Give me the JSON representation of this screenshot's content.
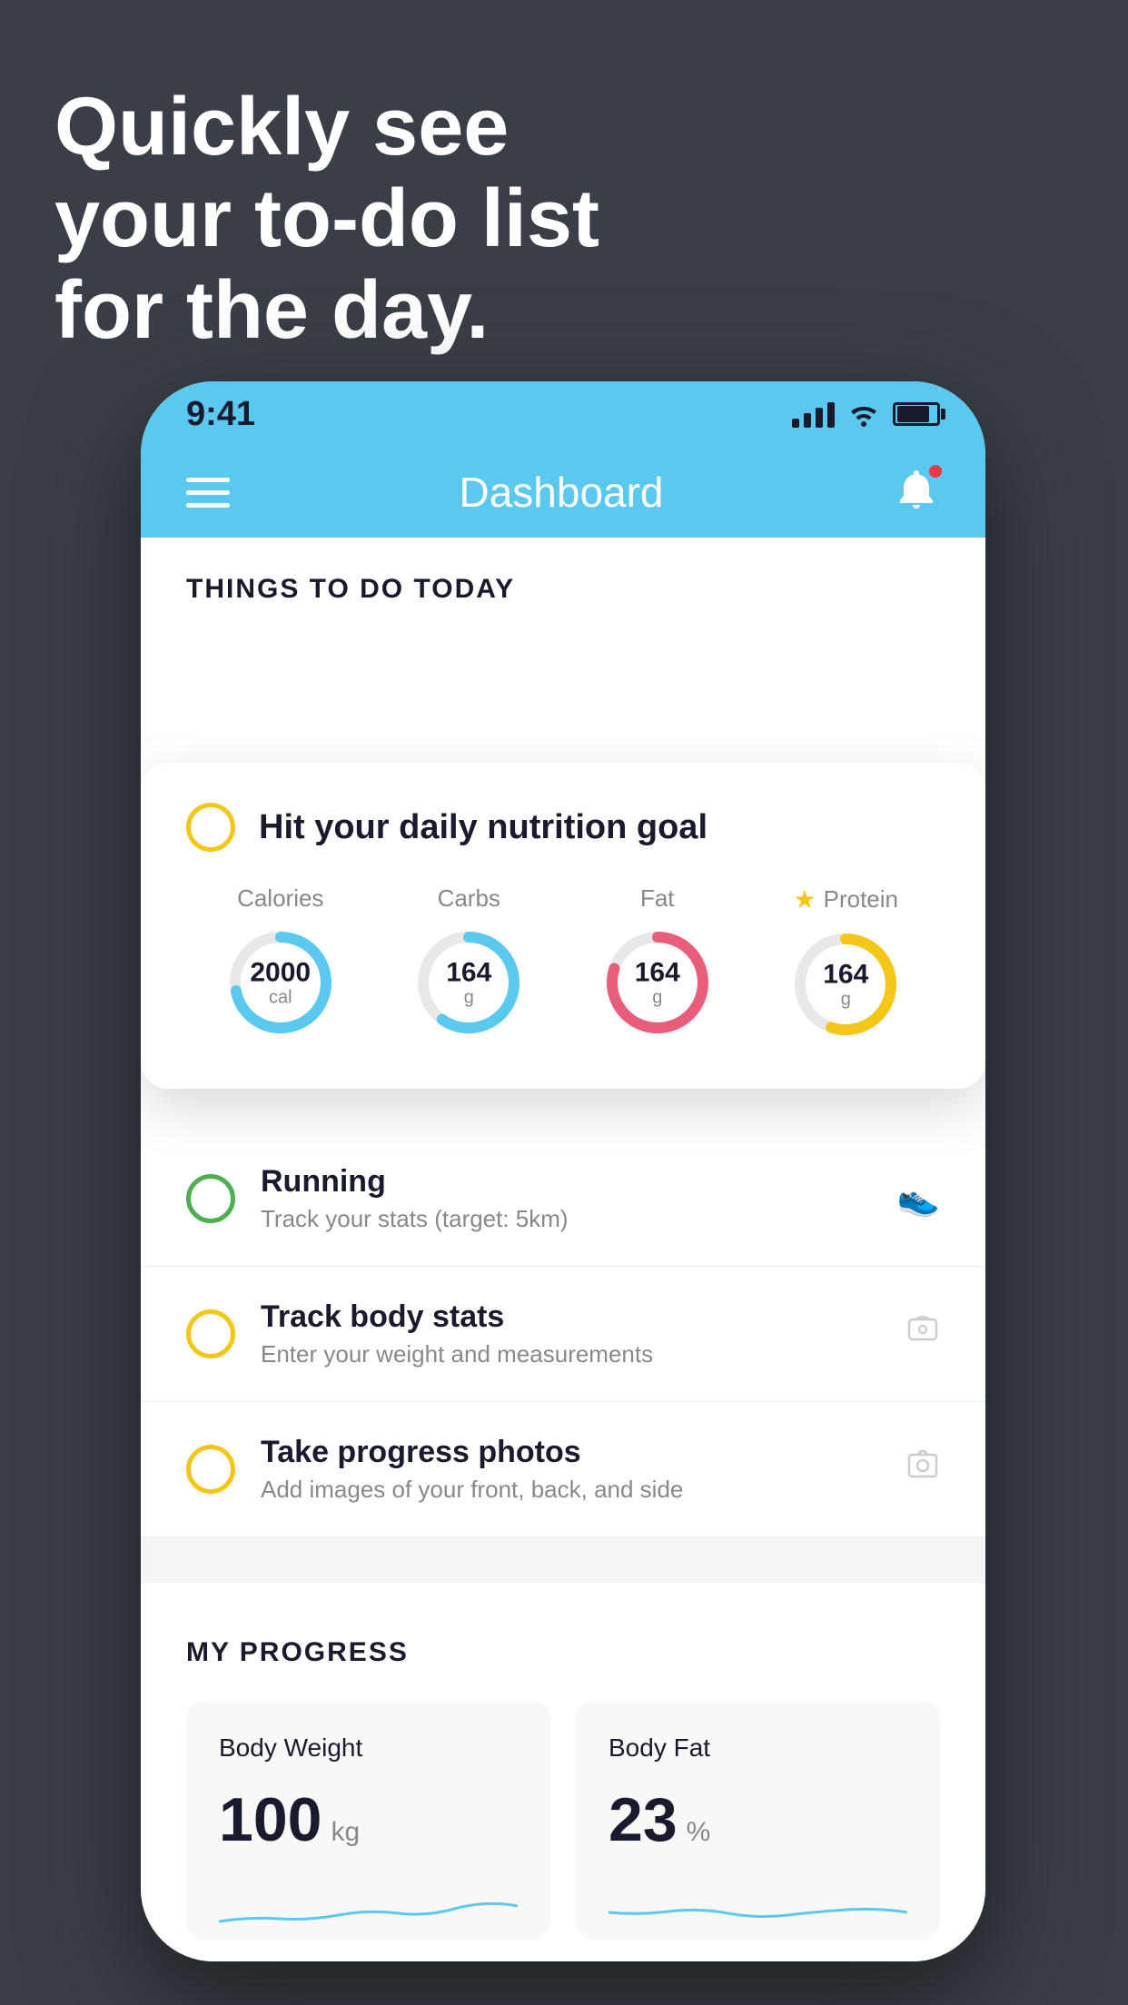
{
  "headline": {
    "line1": "Quickly see",
    "line2": "your to-do list",
    "line3": "for the day."
  },
  "status_bar": {
    "time": "9:41"
  },
  "nav": {
    "title": "Dashboard"
  },
  "things_today": {
    "header": "THINGS TO DO TODAY",
    "floating_card": {
      "title": "Hit your daily nutrition goal",
      "macros": [
        {
          "label": "Calories",
          "value": "2000",
          "unit": "cal",
          "color": "#5bc8f0",
          "percent": 72,
          "starred": false
        },
        {
          "label": "Carbs",
          "value": "164",
          "unit": "g",
          "color": "#5bc8f0",
          "percent": 60,
          "starred": false
        },
        {
          "label": "Fat",
          "value": "164",
          "unit": "g",
          "color": "#e85d7a",
          "percent": 80,
          "starred": false
        },
        {
          "label": "Protein",
          "value": "164",
          "unit": "g",
          "color": "#f5c518",
          "percent": 55,
          "starred": true
        }
      ]
    },
    "items": [
      {
        "title": "Running",
        "subtitle": "Track your stats (target: 5km)",
        "circle_color": "green",
        "icon": "👟"
      },
      {
        "title": "Track body stats",
        "subtitle": "Enter your weight and measurements",
        "circle_color": "yellow",
        "icon": "⚖"
      },
      {
        "title": "Take progress photos",
        "subtitle": "Add images of your front, back, and side",
        "circle_color": "orange",
        "icon": "👤"
      }
    ]
  },
  "my_progress": {
    "header": "MY PROGRESS",
    "cards": [
      {
        "title": "Body Weight",
        "value": "100",
        "unit": "kg"
      },
      {
        "title": "Body Fat",
        "value": "23",
        "unit": "%"
      }
    ]
  }
}
